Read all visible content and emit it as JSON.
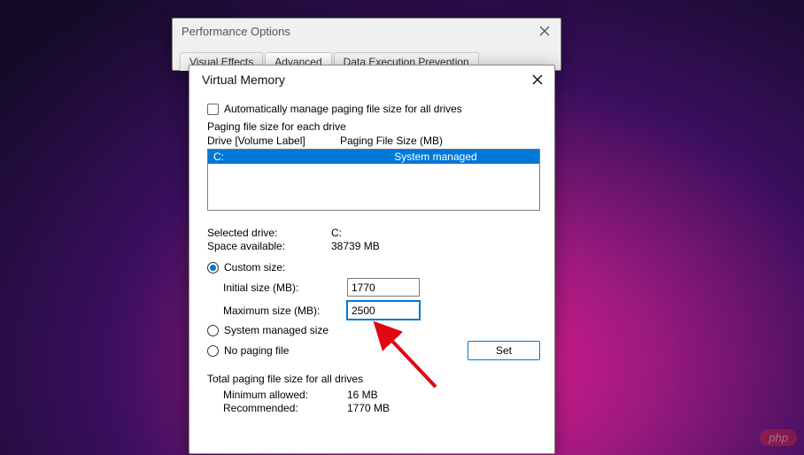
{
  "perf": {
    "title": "Performance Options",
    "tabs": [
      "Visual Effects",
      "Advanced",
      "Data Execution Prevention"
    ]
  },
  "vm": {
    "title": "Virtual Memory",
    "auto_manage": "Automatically manage paging file size for all drives",
    "group_label": "Paging file size for each drive",
    "drive_header_left": "Drive  [Volume Label]",
    "drive_header_right": "Paging File Size (MB)",
    "drives": [
      {
        "label": "C:",
        "size": "System managed"
      }
    ],
    "selected_drive_label": "Selected drive:",
    "selected_drive_value": "C:",
    "space_label": "Space available:",
    "space_value": "38739 MB",
    "custom_size": "Custom size:",
    "initial_label": "Initial size (MB):",
    "initial_value": "1770",
    "max_label": "Maximum size (MB):",
    "max_value": "2500",
    "system_managed": "System managed size",
    "no_paging": "No paging file",
    "set_button": "Set",
    "total_label": "Total paging file size for all drives",
    "min_label": "Minimum allowed:",
    "min_value": "16 MB",
    "rec_label": "Recommended:",
    "rec_value": "1770 MB"
  },
  "watermark": "php"
}
